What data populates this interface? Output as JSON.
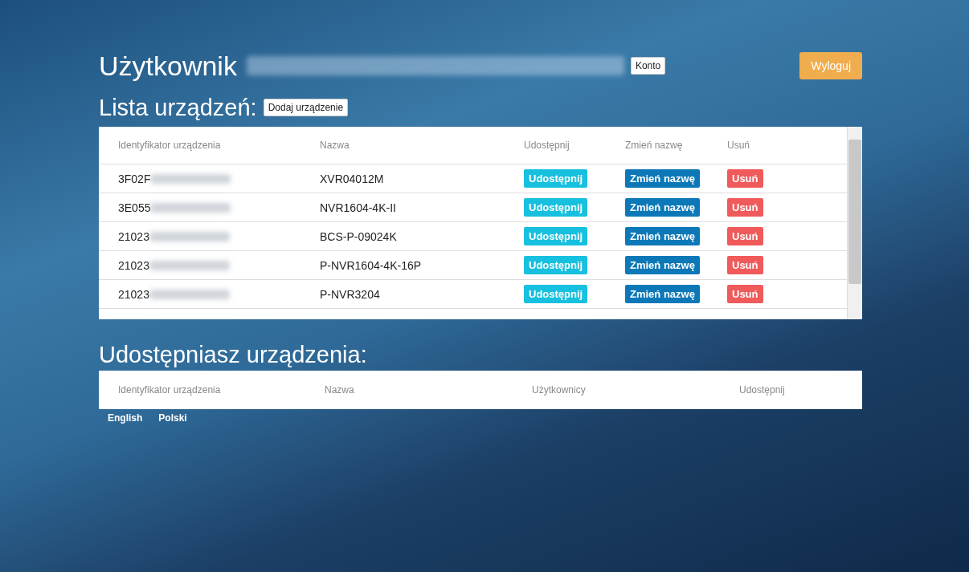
{
  "header": {
    "title": "Użytkownik",
    "account_button": "Konto",
    "logout_button": "Wyloguj"
  },
  "devices": {
    "title": "Lista urządzeń:",
    "add_button": "Dodaj urządzenie",
    "columns": [
      "Identyfikator urządzenia",
      "Nazwa",
      "Udostępnij",
      "Zmień nazwę",
      "Usuń"
    ],
    "rows": [
      {
        "id": "3F02F",
        "name": "XVR04012M",
        "share": "Udostępnij",
        "rename": "Zmień nazwę",
        "delete": "Usuń"
      },
      {
        "id": "3E055",
        "name": "NVR1604-4K-II",
        "share": "Udostępnij",
        "rename": "Zmień nazwę",
        "delete": "Usuń"
      },
      {
        "id": "21023",
        "name": "BCS-P-09024K",
        "share": "Udostępnij",
        "rename": "Zmień nazwę",
        "delete": "Usuń"
      },
      {
        "id": "21023",
        "name": "P-NVR1604-4K-16P",
        "share": "Udostępnij",
        "rename": "Zmień nazwę",
        "delete": "Usuń"
      },
      {
        "id": "21023",
        "name": "P-NVR3204",
        "share": "Udostępnij",
        "rename": "Zmień nazwę",
        "delete": "Usuń"
      }
    ]
  },
  "shared": {
    "title": "Udostępniasz urządzenia:",
    "columns": [
      "Identyfikator urządzenia",
      "Nazwa",
      "Użytkownicy",
      "Udostępnij"
    ]
  },
  "languages": [
    "English",
    "Polski"
  ]
}
